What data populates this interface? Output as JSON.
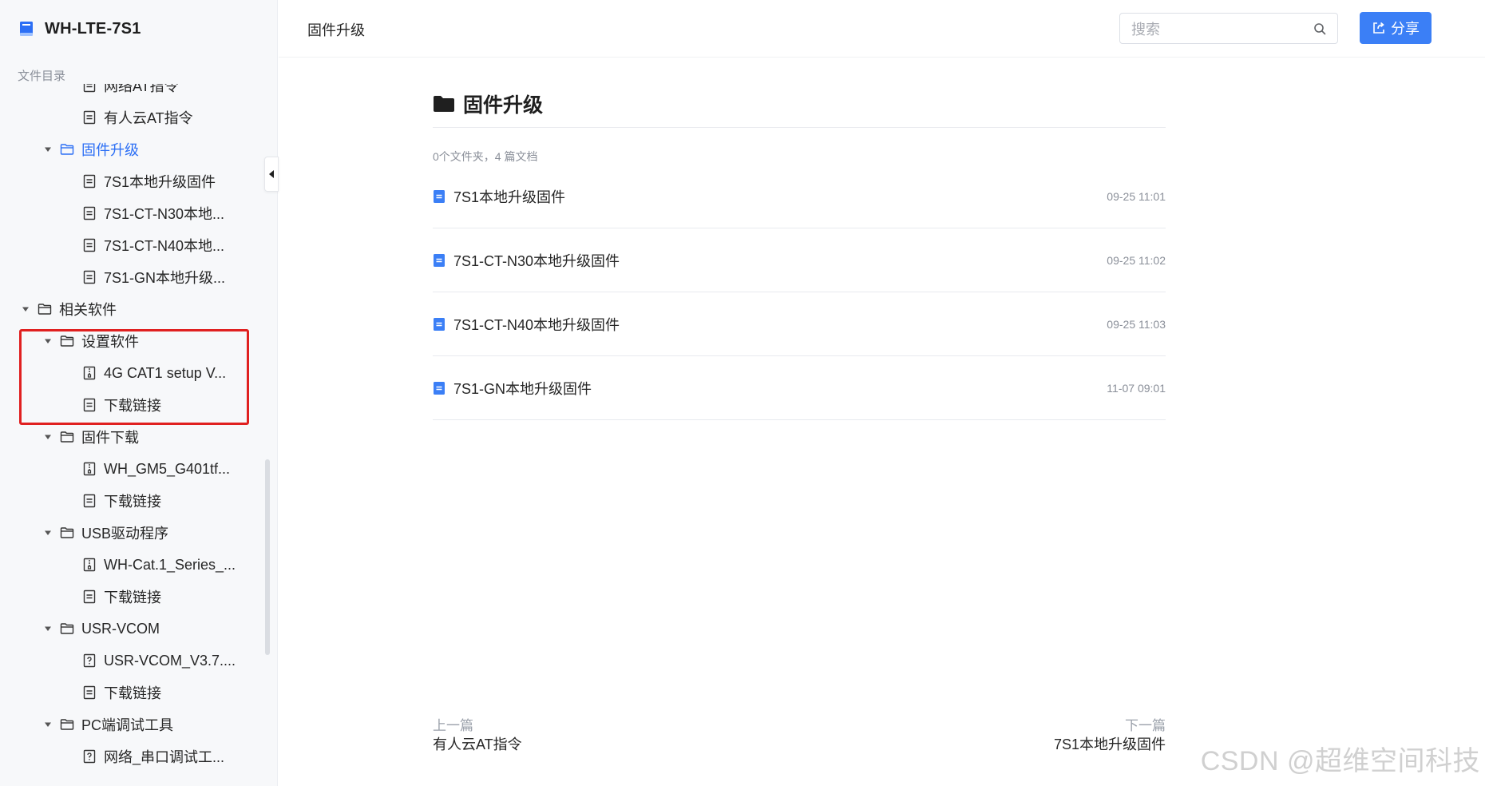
{
  "sidebar": {
    "title": "WH-LTE-7S1",
    "section_label": "文件目录",
    "tree": [
      {
        "label": "网络AT指令",
        "level": 2,
        "icon": "doc-icon",
        "expanded": false,
        "active": false
      },
      {
        "label": "有人云AT指令",
        "level": 2,
        "icon": "doc-icon",
        "expanded": false,
        "active": false
      },
      {
        "label": "固件升级",
        "level": 1,
        "icon": "folder-icon",
        "expanded": true,
        "active": true
      },
      {
        "label": "7S1本地升级固件",
        "level": 2,
        "icon": "doc-icon",
        "expanded": false,
        "active": false
      },
      {
        "label": "7S1-CT-N30本地...",
        "level": 2,
        "icon": "doc-icon",
        "expanded": false,
        "active": false
      },
      {
        "label": "7S1-CT-N40本地...",
        "level": 2,
        "icon": "doc-icon",
        "expanded": false,
        "active": false
      },
      {
        "label": "7S1-GN本地升级...",
        "level": 2,
        "icon": "doc-icon",
        "expanded": false,
        "active": false
      },
      {
        "label": "相关软件",
        "level": 0,
        "icon": "folder-icon",
        "expanded": true,
        "active": false
      },
      {
        "label": "设置软件",
        "level": 1,
        "icon": "folder-icon",
        "expanded": true,
        "active": false
      },
      {
        "label": "4G CAT1 setup V...",
        "level": 2,
        "icon": "archive-icon",
        "expanded": false,
        "active": false
      },
      {
        "label": "下载链接",
        "level": 2,
        "icon": "doc-icon",
        "expanded": false,
        "active": false
      },
      {
        "label": "固件下载",
        "level": 1,
        "icon": "folder-icon",
        "expanded": true,
        "active": false
      },
      {
        "label": "WH_GM5_G401tf...",
        "level": 2,
        "icon": "archive-icon",
        "expanded": false,
        "active": false
      },
      {
        "label": "下载链接",
        "level": 2,
        "icon": "doc-icon",
        "expanded": false,
        "active": false
      },
      {
        "label": "USB驱动程序",
        "level": 1,
        "icon": "folder-icon",
        "expanded": true,
        "active": false
      },
      {
        "label": "WH-Cat.1_Series_...",
        "level": 2,
        "icon": "archive-icon",
        "expanded": false,
        "active": false
      },
      {
        "label": "下载链接",
        "level": 2,
        "icon": "doc-icon",
        "expanded": false,
        "active": false
      },
      {
        "label": "USR-VCOM",
        "level": 1,
        "icon": "folder-icon",
        "expanded": true,
        "active": false
      },
      {
        "label": "USR-VCOM_V3.7....",
        "level": 2,
        "icon": "file-unknown-icon",
        "expanded": false,
        "active": false
      },
      {
        "label": "下载链接",
        "level": 2,
        "icon": "doc-icon",
        "expanded": false,
        "active": false
      },
      {
        "label": "PC端调试工具",
        "level": 1,
        "icon": "folder-icon",
        "expanded": true,
        "active": false
      },
      {
        "label": "网络_串口调试工...",
        "level": 2,
        "icon": "file-unknown-icon",
        "expanded": false,
        "active": false
      }
    ]
  },
  "topbar": {
    "breadcrumb": "固件升级",
    "search_placeholder": "搜索",
    "share_label": "分享"
  },
  "main": {
    "title": "固件升级",
    "stats": "0个文件夹，4 篇文档",
    "docs": [
      {
        "name": "7S1本地升级固件",
        "time": "09-25 11:01"
      },
      {
        "name": "7S1-CT-N30本地升级固件",
        "time": "09-25 11:02"
      },
      {
        "name": "7S1-CT-N40本地升级固件",
        "time": "09-25 11:03"
      },
      {
        "name": "7S1-GN本地升级固件",
        "time": "11-07 09:01"
      }
    ]
  },
  "pager": {
    "prev_label": "上一篇",
    "prev_title": "有人云AT指令",
    "next_label": "下一篇",
    "next_title": "7S1本地升级固件"
  },
  "watermark": "CSDN @超维空间科技",
  "colors": {
    "accent": "#2c6ff5",
    "share_bg": "#3b7ff6",
    "highlight_border": "#e02020",
    "sidebar_bg": "#f7f8fa"
  }
}
